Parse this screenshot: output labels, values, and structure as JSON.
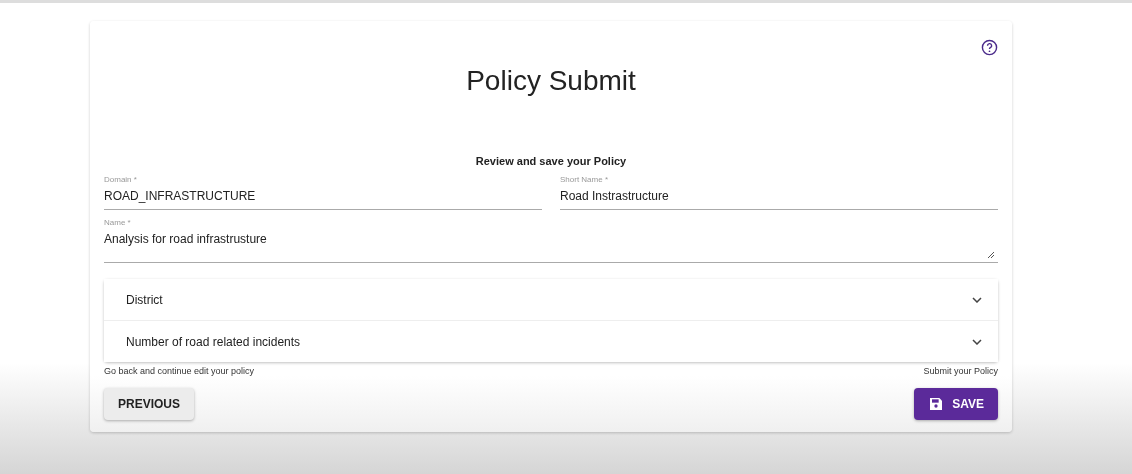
{
  "card": {
    "title": "Policy Submit",
    "subtitle": "Review and save your Policy",
    "fields": [
      {
        "label": "Domain *",
        "value": "ROAD_INFRASTRUCTURE"
      },
      {
        "label": "Short Name *",
        "value": "Road Instrastructure"
      }
    ],
    "name_field": {
      "label": "Name *",
      "value": "Analysis for road infrastrusture"
    },
    "accordion": [
      {
        "label": "District",
        "expanded": false
      },
      {
        "label": "Number of road related incidents",
        "expanded": false
      }
    ],
    "footer": {
      "left_hint": "Go back and continue edit your policy",
      "right_hint": "Submit your Policy",
      "previous_button": "PREVIOUS",
      "save_button": "SAVE"
    }
  }
}
